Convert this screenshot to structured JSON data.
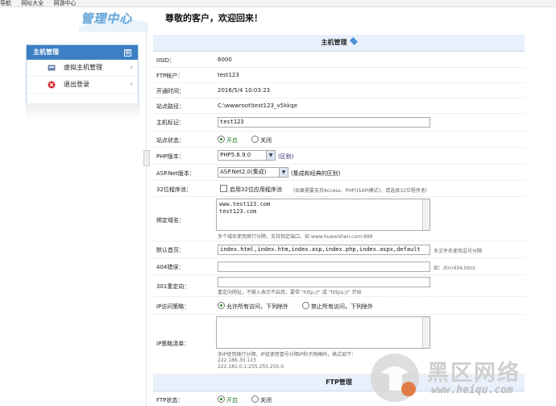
{
  "browser_bar": {
    "items": [
      "导航",
      "网址大全",
      "网游中心"
    ]
  },
  "brand": {
    "title": "管理中心"
  },
  "welcome": "尊敬的客户，欢迎回来！",
  "left_panel": {
    "title": "主机管理",
    "toggle": "⊞",
    "items": [
      {
        "label": "虚拟主机管理",
        "icon": "host-icon"
      },
      {
        "label": "退出登录",
        "icon": "logout-icon"
      }
    ]
  },
  "main": {
    "section_host": "主机管理",
    "section_ftp": "FTP管理",
    "iisid": {
      "label": "IISID：",
      "value": "6000"
    },
    "ftp_account": {
      "label": "FTP帐户：",
      "value": "test123"
    },
    "open_time": {
      "label": "开通时间：",
      "value": "2016/5/4 10:03:23"
    },
    "site_path": {
      "label": "站点路径：",
      "value": "C:\\wwwroot\\test123_v5kkqe"
    },
    "host_tag": {
      "label": "主机标记：",
      "value": "test123"
    },
    "site_status": {
      "label": "站点状态：",
      "opt_on": "开启",
      "opt_off": "关闭",
      "selected": "开启"
    },
    "php_version": {
      "label": "PHP版本：",
      "value": "PHP5.6.9.0",
      "note": "(区别)"
    },
    "aspnet_version": {
      "label": "ASP.Net版本：",
      "value": "ASP.Net2.0(集成)",
      "note": "(集成和经典的区别)"
    },
    "pool32": {
      "label": "32位程序池：",
      "check_label": "启用32位应用程序池",
      "note": "（如果需要支持Access、PHP(ISAPI模式)，请选择32位程序池）"
    },
    "bind_domain": {
      "label": "绑定域名：",
      "lines": [
        "www.test123.com",
        "test123.com"
      ],
      "hint": "多个域名使用换行分隔，支持指定端口，如 www.huweishen.com:999"
    },
    "default_page": {
      "label": "默认首页：",
      "value": "index.html,index.htm,index.asp,index.php,index.aspx,default",
      "hint": "多文件名使用逗号分隔"
    },
    "err404": {
      "label": "404错误：",
      "value": "",
      "hint": "如：/Err/404.html"
    },
    "redirect301": {
      "label": "301重定向：",
      "value": "",
      "hint": "重定向网址，不输入表示不启用，要带 \"http://\" 或 \"https://\" 开始"
    },
    "ip_policy": {
      "label": "IP访问策略：",
      "opt_allow": "允许所有访问，下列除外",
      "opt_deny": "禁止所有访问，下列除外",
      "selected": "允许所有访问，下列除外"
    },
    "ip_list": {
      "label": "IP策略清单：",
      "hint": "多IP使用换行分隔，IP组使用冒号分隔IP和子网掩码，格式如下：",
      "example1": "222.186.30.123",
      "example2": "222.181.0.1:255.255.255.0"
    },
    "ftp_status": {
      "label": "FTP状态：",
      "opt_on": "开启",
      "opt_off": "关闭",
      "selected": "开启"
    }
  },
  "watermark": {
    "text": "黑区网络",
    "url": "www.heiqu.com"
  },
  "colors": {
    "panel_header": "#3d7fc4",
    "section_bg": "#e8f0fb",
    "brand": "#6aa8da"
  }
}
